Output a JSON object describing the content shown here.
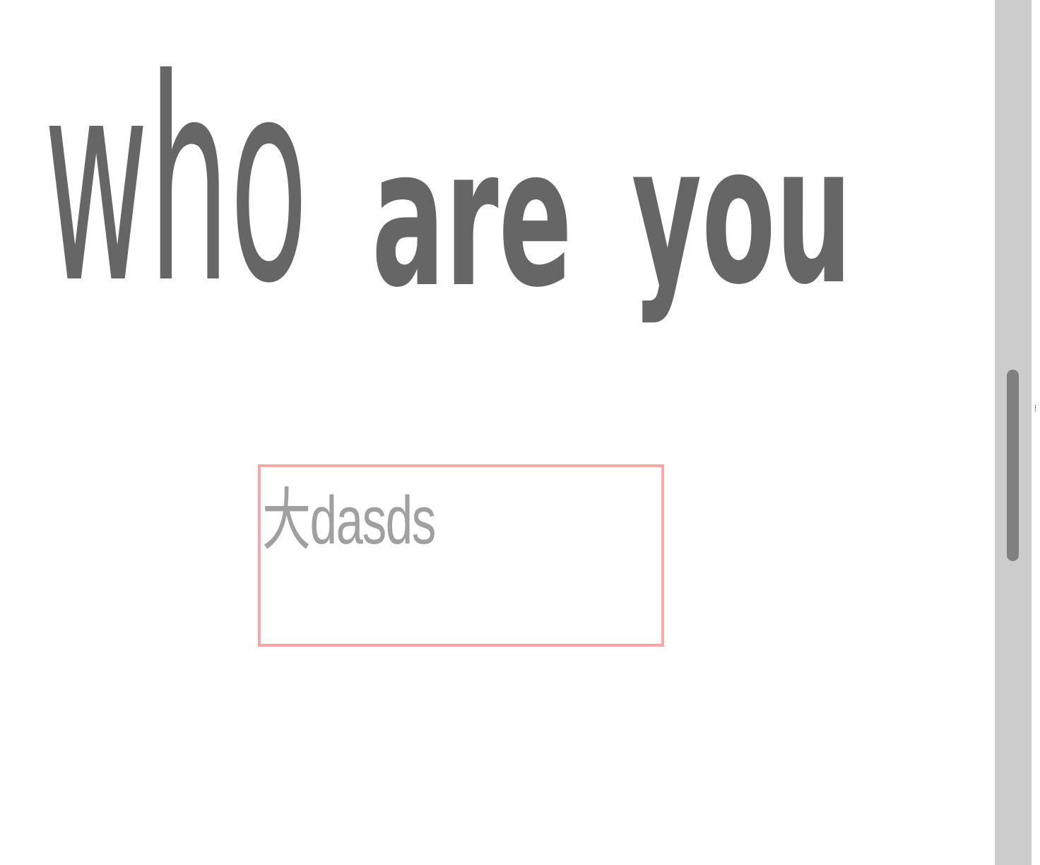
{
  "heading": {
    "word_1": "who",
    "word_2": "are",
    "word_3": "you"
  },
  "text_box": {
    "value": "大dasds"
  },
  "scrollbar": {
    "position_fraction": 0.43,
    "visible_fraction": 0.22
  },
  "colors": {
    "heading_text": "#666666",
    "input_text": "#a0a0a0",
    "input_border": "#ffa6a6",
    "scrollbar_track": "#cccccc",
    "scrollbar_thumb": "#808080",
    "background": "#ffffff"
  },
  "icons": {
    "resize_grip": "vertical-dots-icon"
  }
}
